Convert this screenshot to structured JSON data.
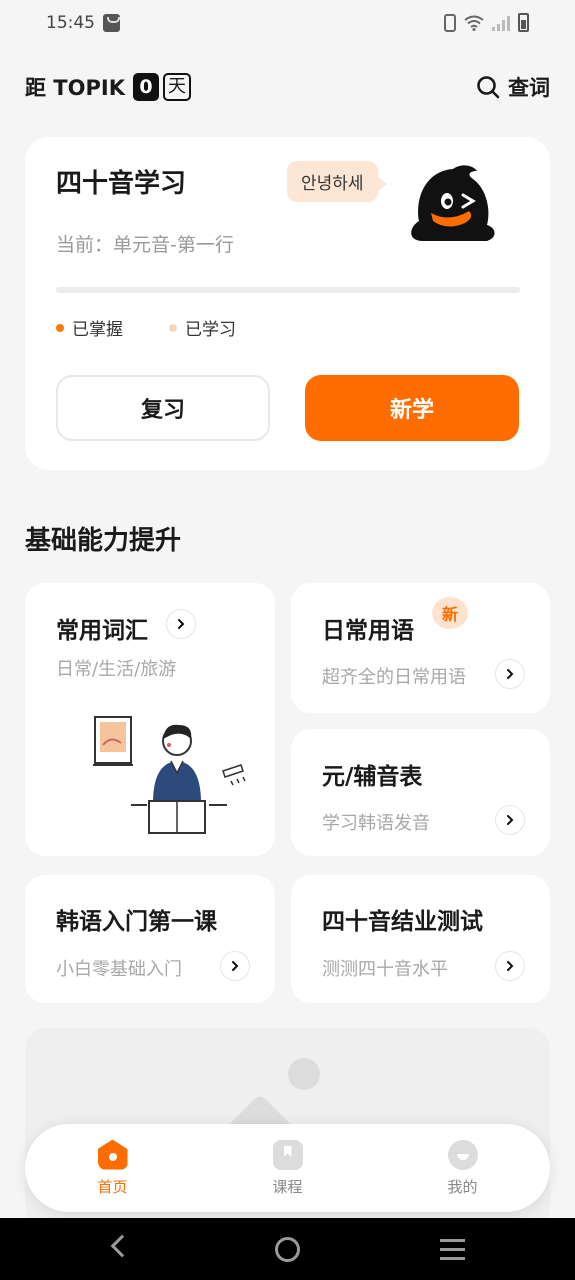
{
  "status_bar": {
    "time": "15:45"
  },
  "header": {
    "countdown_prefix": "距 TOPIK",
    "countdown_days": "0",
    "countdown_unit": "天",
    "lookup_label": "查词"
  },
  "hero": {
    "title": "四十音学习",
    "current": "当前：单元音-第一行",
    "speech_bubble": "안녕하세",
    "progress_mastered": 0,
    "progress_learned": 0,
    "legend_mastered": "已掌握",
    "legend_learned": "已学习",
    "review_button": "复习",
    "new_button": "新学",
    "colors": {
      "accent": "#ff6d00",
      "mastered_dot": "#ff7a00",
      "learned_dot": "#fbd7b7"
    }
  },
  "section": {
    "title": "基础能力提升",
    "cards": [
      {
        "title": "常用词汇",
        "subtitle": "日常/生活/旅游"
      },
      {
        "title": "日常用语",
        "subtitle": "超齐全的日常用语",
        "badge": "新"
      },
      {
        "title": "元/辅音表",
        "subtitle": "学习韩语发音"
      },
      {
        "title": "韩语入门第一课",
        "subtitle": "小白零基础入门"
      },
      {
        "title": "四十音结业测试",
        "subtitle": "测测四十音水平"
      }
    ]
  },
  "bottom_nav": {
    "items": [
      {
        "label": "首页",
        "icon": "home-icon",
        "active": true
      },
      {
        "label": "课程",
        "icon": "bookmark-icon",
        "active": false
      },
      {
        "label": "我的",
        "icon": "profile-icon",
        "active": false
      }
    ]
  }
}
